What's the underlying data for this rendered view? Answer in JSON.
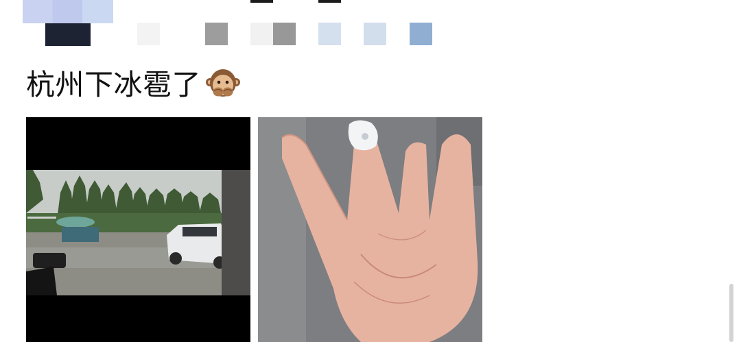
{
  "post": {
    "text": "杭州下冰雹了",
    "emoji_icon": "see-no-evil-monkey-icon"
  },
  "photos": [
    {
      "subject": "rainy-yard-with-white-car",
      "icon": "photo-thumbnail"
    },
    {
      "subject": "hand-holding-hailstone",
      "icon": "photo-thumbnail"
    }
  ],
  "colors": {
    "background": "#ffffff",
    "text": "#111111",
    "mosaic_dark": "#1d2333",
    "mosaic_gray": "#9a9a9a",
    "mosaic_blue": "#9ab6d6"
  }
}
